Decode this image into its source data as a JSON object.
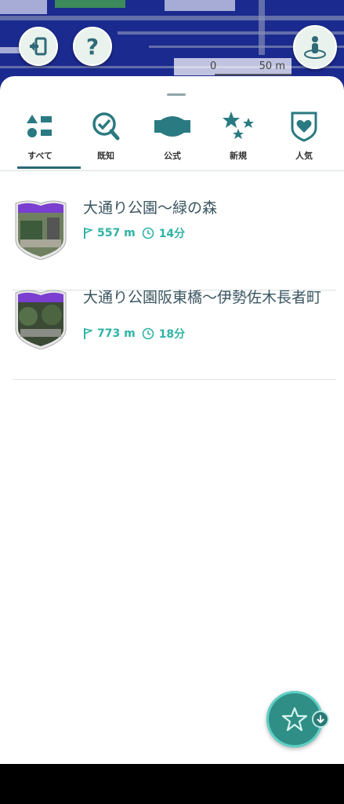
{
  "map": {
    "scale_start": "0",
    "scale_end": "50 m"
  },
  "top_buttons": {
    "help_label": "?"
  },
  "tabs": [
    {
      "label": "すべて",
      "selected": true
    },
    {
      "label": "既知",
      "selected": false
    },
    {
      "label": "公式",
      "selected": false
    },
    {
      "label": "新規",
      "selected": false
    },
    {
      "label": "人気",
      "selected": false
    }
  ],
  "routes": [
    {
      "title": "大通り公園〜緑の森",
      "distance": "557 m",
      "duration": "14分"
    },
    {
      "title": "大通り公園阪東橋〜伊勢佐木長者町",
      "distance": "773 m",
      "duration": "18分"
    }
  ],
  "colors": {
    "accent": "#2fb3a5",
    "primary_dark": "#2a6a74",
    "map_blue": "#1b2a8f"
  }
}
